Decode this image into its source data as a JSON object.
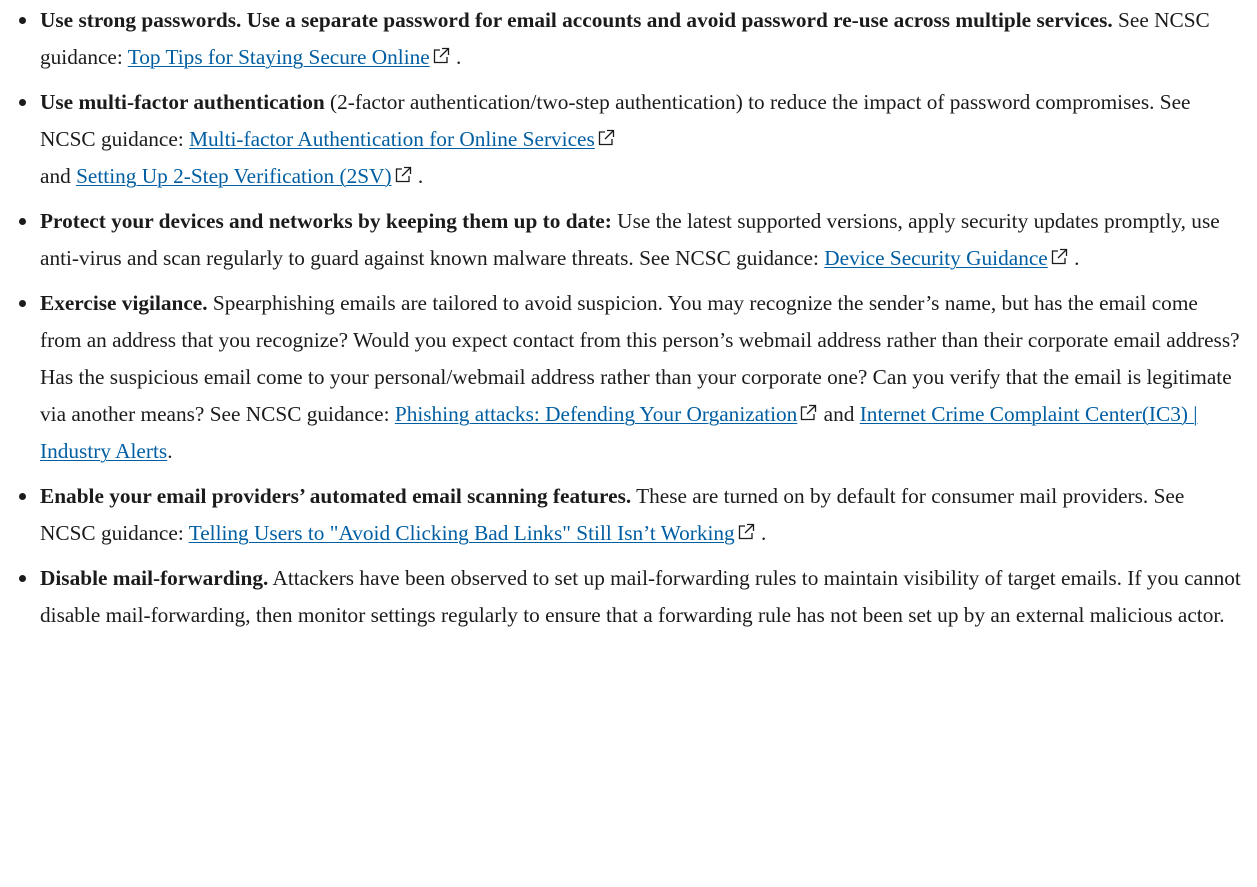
{
  "colors": {
    "text": "#1b1b1b",
    "link": "#005ea2"
  },
  "icons": {
    "external": "external-link-icon"
  },
  "items": [
    {
      "lead": "Use strong passwords. Use a separate password for email accounts and avoid password re-use across multiple services.",
      "body": " See NCSC guidance: ",
      "link1": "Top Tips for Staying Secure Online",
      "tail": " ."
    },
    {
      "lead": "Use multi-factor authentication",
      "body": " (2-factor authentication/two-step authentication) to reduce the impact of password compromises. See NCSC guidance: ",
      "link1": "Multi-factor Authentication for Online Services",
      "mid": " and ",
      "link2": "Setting Up 2-Step Verification (2SV)",
      "tail": " ."
    },
    {
      "lead": "Protect your devices and networks by keeping them up to date:",
      "body": " Use the latest supported versions, apply security updates promptly, use anti-virus and scan regularly to guard against known malware threats. See NCSC guidance: ",
      "link1": "Device Security Guidance",
      "tail": " ."
    },
    {
      "lead": "Exercise vigilance.",
      "body": " Spearphishing emails are tailored to avoid suspicion. You may recognize the sender’s name, but has the email come from an address that you recognize? Would you expect contact from this person’s webmail address rather than their corporate email address? Has the suspicious email come to your personal/webmail address rather than your corporate one? Can you verify that the email is legitimate via another means? See NCSC guidance: ",
      "link1": "Phishing attacks: Defending Your Organization",
      "mid": " and ",
      "link2": "Internet Crime Complaint Center(IC3) | Industry Alerts",
      "tail": "."
    },
    {
      "lead": "Enable your email providers’ automated email scanning features.",
      "body": " These are turned on by default for consumer mail providers. See NCSC guidance: ",
      "link1": "Telling Users to \"Avoid Clicking Bad Links\" Still Isn’t Working",
      "tail": " ."
    },
    {
      "lead": "Disable mail-forwarding.",
      "body": " Attackers have been observed to set up mail-forwarding rules to maintain visibility of target emails. If you cannot disable mail-forwarding, then monitor settings regularly to ensure that a forwarding rule has not been set up by an external malicious actor."
    }
  ]
}
